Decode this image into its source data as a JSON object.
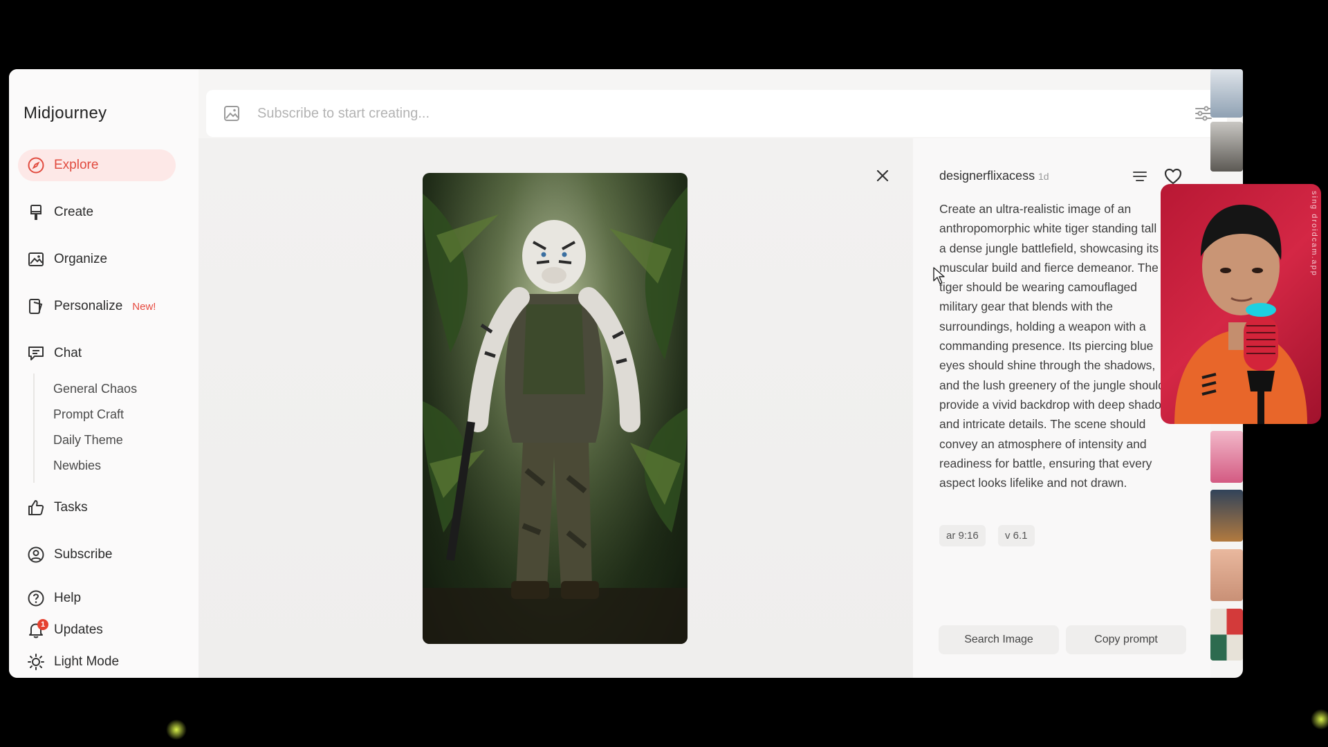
{
  "app": {
    "title": "Midjourney"
  },
  "sidebar": {
    "items": [
      {
        "label": "Explore",
        "icon": "compass-icon"
      },
      {
        "label": "Create",
        "icon": "brush-icon"
      },
      {
        "label": "Organize",
        "icon": "image-icon"
      },
      {
        "label": "Personalize",
        "icon": "personalize-icon",
        "badge": "New!"
      },
      {
        "label": "Chat",
        "icon": "chat-icon"
      },
      {
        "label": "Tasks",
        "icon": "thumbs-up-icon"
      },
      {
        "label": "Subscribe",
        "icon": "user-circle-icon"
      },
      {
        "label": "Help",
        "icon": "help-icon"
      },
      {
        "label": "Updates",
        "icon": "bell-icon",
        "count": "1"
      },
      {
        "label": "Light Mode",
        "icon": "sun-icon"
      }
    ],
    "chat_channels": [
      "General Chaos",
      "Prompt Craft",
      "Daily Theme",
      "Newbies"
    ]
  },
  "search": {
    "placeholder": "Subscribe to start creating..."
  },
  "detail": {
    "author": "designerflixacess",
    "time": "1d",
    "prompt": "Create an ultra-realistic image of an anthropomorphic white tiger standing tall in a dense jungle battlefield, showcasing its muscular build and fierce demeanor. The tiger should be wearing camouflaged military gear that blends with the surroundings, holding a weapon with a commanding presence. Its piercing blue eyes should shine through the shadows, and the lush greenery of the jungle should provide a vivid backdrop with deep shadows and intricate details. The scene should convey an atmosphere of intensity and readiness for battle, ensuring that every aspect looks lifelike and not drawn.",
    "params": [
      "ar 9:16",
      "v 6.1"
    ],
    "buttons": {
      "search_image": "Search Image",
      "copy_prompt": "Copy prompt"
    }
  },
  "webcam": {
    "watermark": "sing droidcam.app"
  },
  "colors": {
    "accent": "#e14b3f",
    "active_bg": "#fde8e7",
    "background": "#000000"
  }
}
